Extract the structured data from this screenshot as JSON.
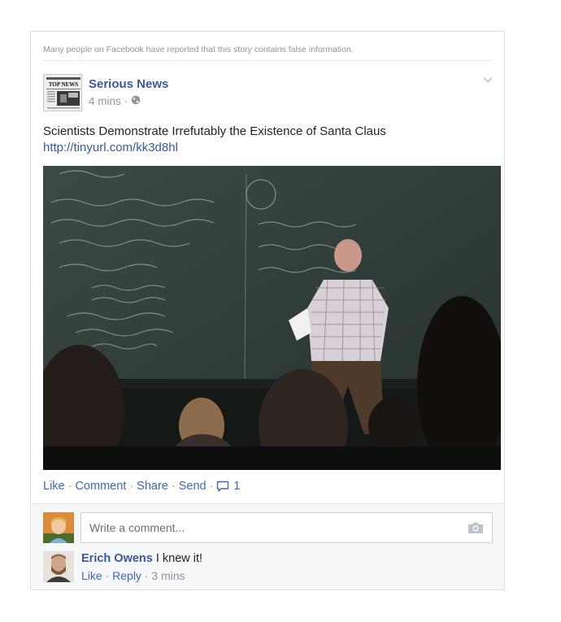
{
  "warning": "Many people on Facebook have reported that this story contains false information.",
  "post": {
    "page_name": "Serious News",
    "avatar_label": "TOP NEWS",
    "time": "4 mins",
    "dot": "·",
    "headline": "Scientists Demonstrate Irrefutably the Existence of Santa Claus",
    "link": "http://tinyurl.com/kk3d8hl",
    "actions": {
      "like": "Like",
      "comment": "Comment",
      "share": "Share",
      "send": "Send",
      "comment_count": "1",
      "sep": "·"
    }
  },
  "composer": {
    "placeholder": "Write a comment..."
  },
  "comment": {
    "author": "Erich Owens",
    "text": "I knew it!",
    "like": "Like",
    "reply": "Reply",
    "time": "3 mins",
    "sep": "·"
  },
  "colors": {
    "link_blue": "#3b5998",
    "action_blue": "#4267b2",
    "muted_gray": "#90949c"
  },
  "icons": [
    "globe-icon",
    "chevron-down-icon",
    "comment-bubble-icon",
    "camera-icon"
  ]
}
